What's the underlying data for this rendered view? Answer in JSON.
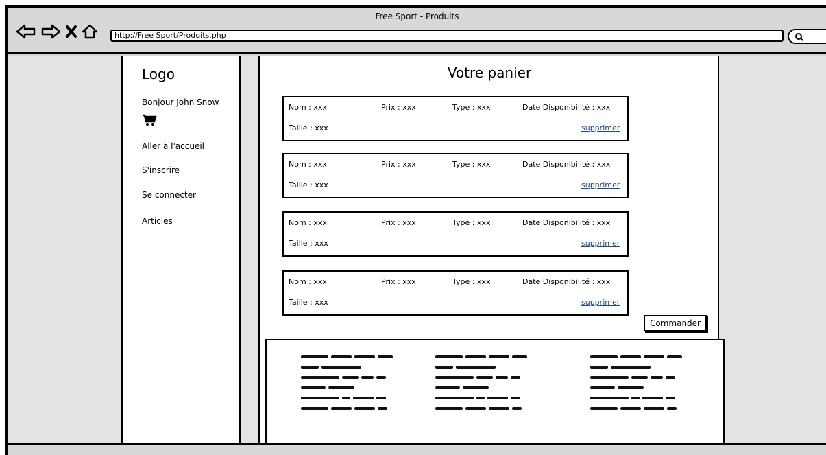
{
  "browser": {
    "title": "Free Sport - Produits",
    "url": "http://Free Sport/Produits.php"
  },
  "sidebar": {
    "logo": "Logo",
    "greeting": "Bonjour John Snow",
    "cart_icon": "cart-icon",
    "links": [
      "Aller à l'accueil",
      "S'inscrire",
      "Se connecter",
      "Articles"
    ]
  },
  "main": {
    "title": "Votre panier",
    "items": [
      {
        "nom": "Nom :  xxx",
        "prix": "Prix :  xxx",
        "type": "Type :  xxx",
        "date": "Date Disponibilité :    xxx",
        "taille": "Taille :  xxx",
        "delete": "supprimer"
      },
      {
        "nom": "Nom :  xxx",
        "prix": "Prix :  xxx",
        "type": "Type :  xxx",
        "date": "Date Disponibilité :    xxx",
        "taille": "Taille :  xxx",
        "delete": "supprimer"
      },
      {
        "nom": "Nom :  xxx",
        "prix": "Prix :  xxx",
        "type": "Type :  xxx",
        "date": "Date Disponibilité :    xxx",
        "taille": "Taille :  xxx",
        "delete": "supprimer"
      },
      {
        "nom": "Nom :  xxx",
        "prix": "Prix :  xxx",
        "type": "Type :  xxx",
        "date": "Date Disponibilité :    xxx",
        "taille": "Taille :  xxx",
        "delete": "supprimer"
      }
    ],
    "order_button": "Commander"
  },
  "colors": {
    "link": "#1a4a99",
    "chrome": "#d8d8d8",
    "background": "#e3e3e3"
  }
}
